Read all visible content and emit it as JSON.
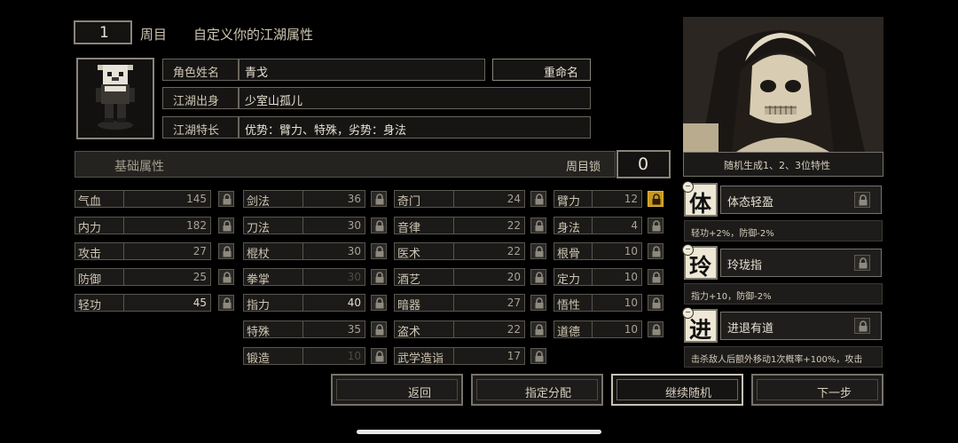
{
  "header": {
    "round_number": "1",
    "round_label": "周目",
    "title": "自定义你的江湖属性"
  },
  "profile": {
    "name_label": "角色姓名",
    "name_value": "青戈",
    "rename_button": "重命名",
    "origin_label": "江湖出身",
    "origin_value": "少室山孤儿",
    "specialty_label": "江湖特长",
    "specialty_value": "优势：臂力、特殊，劣势：身法"
  },
  "base_attr": {
    "title": "基础属性",
    "round_lock_label": "周目锁",
    "round_lock_value": "0"
  },
  "stats": {
    "col1": [
      {
        "name": "气血",
        "value": "145"
      },
      {
        "name": "内力",
        "value": "182"
      },
      {
        "name": "攻击",
        "value": "27"
      },
      {
        "name": "防御",
        "value": "25"
      },
      {
        "name": "轻功",
        "value": "45"
      }
    ],
    "col2": [
      {
        "name": "剑法",
        "value": "36"
      },
      {
        "name": "刀法",
        "value": "30"
      },
      {
        "name": "棍杖",
        "value": "30"
      },
      {
        "name": "拳掌",
        "value": "30"
      },
      {
        "name": "指力",
        "value": "40"
      },
      {
        "name": "特殊",
        "value": "35"
      },
      {
        "name": "锻造",
        "value": "10"
      }
    ],
    "col3": [
      {
        "name": "奇门",
        "value": "24"
      },
      {
        "name": "音律",
        "value": "22"
      },
      {
        "name": "医术",
        "value": "22"
      },
      {
        "name": "酒艺",
        "value": "20"
      },
      {
        "name": "暗器",
        "value": "27"
      },
      {
        "name": "盗术",
        "value": "22"
      },
      {
        "name": "武学造诣",
        "value": "17"
      }
    ],
    "col4": [
      {
        "name": "臂力",
        "value": "12"
      },
      {
        "name": "身法",
        "value": "4"
      },
      {
        "name": "根骨",
        "value": "10"
      },
      {
        "name": "定力",
        "value": "10"
      },
      {
        "name": "悟性",
        "value": "10"
      },
      {
        "name": "道德",
        "value": "10"
      }
    ]
  },
  "buttons": {
    "back": "返回",
    "assign": "指定分配",
    "reroll": "继续随机",
    "next": "下一步"
  },
  "traits_panel": {
    "header": "随机生成1、2、3位特性",
    "traits": [
      {
        "icon_char": "体",
        "name": "体态轻盈",
        "desc": "轻功+2%，防御-2%"
      },
      {
        "icon_char": "玲",
        "name": "玲珑指",
        "desc": "指力+10，防御-2%"
      },
      {
        "icon_char": "进",
        "name": "进退有道",
        "desc": "击杀敌人后额外移动1次概率+100%，攻击"
      }
    ]
  },
  "colors": {
    "lock_active": "#c9961e",
    "panel_border": "#8a857a",
    "text": "#cfc6b3"
  }
}
